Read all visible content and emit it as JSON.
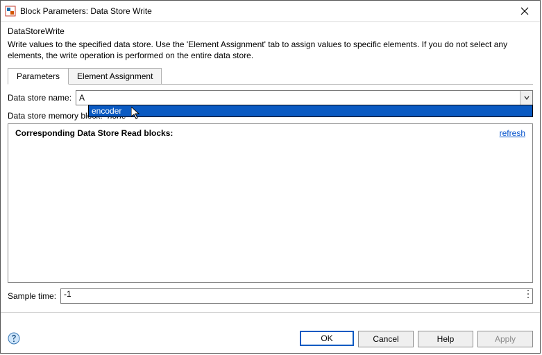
{
  "window": {
    "title": "Block Parameters: Data Store Write"
  },
  "heading": "DataStoreWrite",
  "description": "Write values to the specified data store. Use the 'Element Assignment' tab to assign values to specific elements. If you do not select any elements, the write operation is performed on the entire data store.",
  "tabs": {
    "parameters": "Parameters",
    "element_assignment": "Element Assignment"
  },
  "labels": {
    "data_store_name": "Data store name:",
    "data_store_memory_block": "Data store memory block:",
    "corresponding_reads": "Corresponding Data Store Read blocks:",
    "refresh": "refresh",
    "sample_time": "Sample time:"
  },
  "values": {
    "data_store_name": "A",
    "memory_block": "none",
    "sample_time": "-1"
  },
  "dropdown_options": [
    "encoder"
  ],
  "buttons": {
    "ok": "OK",
    "cancel": "Cancel",
    "help": "Help",
    "apply": "Apply"
  },
  "icons": {
    "app": "app-icon",
    "close": "✕",
    "help": "help-icon",
    "dots": "⋮"
  },
  "colors": {
    "selection": "#0a5ac2",
    "link": "#0050cc"
  }
}
